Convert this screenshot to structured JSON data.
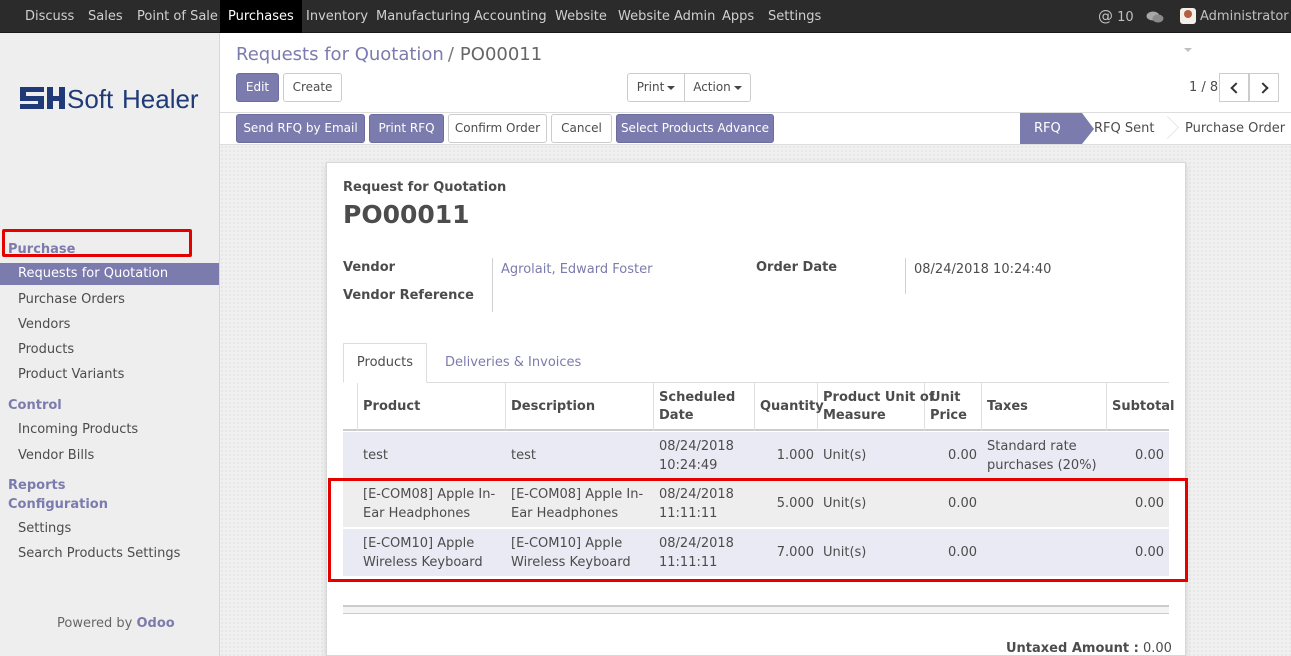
{
  "topbar": {
    "menu": [
      "Discuss",
      "Sales",
      "Point of Sale",
      "Purchases",
      "Inventory",
      "Manufacturing",
      "Accounting",
      "Website",
      "Website Admin",
      "Apps",
      "Settings"
    ],
    "active": "Purchases",
    "mentions_count": "10",
    "user": "Administrator"
  },
  "sidebar": {
    "logo_text": "SoftHealer",
    "sections": [
      {
        "title": "Purchase",
        "items": [
          "Requests for Quotation",
          "Purchase Orders",
          "Vendors",
          "Products",
          "Product Variants"
        ]
      },
      {
        "title": "Control",
        "items": [
          "Incoming Products",
          "Vendor Bills"
        ]
      },
      {
        "title": "Reports",
        "items": []
      },
      {
        "title": "Configuration",
        "items": [
          "Settings",
          "Search Products Settings"
        ]
      }
    ],
    "active_item": "Requests for Quotation",
    "powered_prefix": "Powered by",
    "powered_brand": "Odoo"
  },
  "breadcrumb": {
    "parent": "Requests for Quotation",
    "separator": "/",
    "current": "PO00011"
  },
  "controls": {
    "edit": "Edit",
    "create": "Create",
    "print": "Print",
    "action": "Action",
    "pager": "1 / 8"
  },
  "header_buttons": [
    "Send RFQ by Email",
    "Print RFQ",
    "Confirm Order",
    "Cancel",
    "Select Products Advance"
  ],
  "status": {
    "stages": [
      "RFQ",
      "RFQ Sent",
      "Purchase Order"
    ],
    "active": "RFQ"
  },
  "form": {
    "doc_type": "Request for Quotation",
    "name": "PO00011",
    "vendor_label": "Vendor",
    "vendor_value": "Agrolait, Edward Foster",
    "vendor_ref_label": "Vendor Reference",
    "vendor_ref_value": "",
    "order_date_label": "Order Date",
    "order_date_value": "08/24/2018 10:24:40"
  },
  "tabs": [
    "Products",
    "Deliveries & Invoices"
  ],
  "table": {
    "headers": {
      "product": "Product",
      "description": "Description",
      "scheduled_1": "Scheduled",
      "scheduled_2": "Date",
      "quantity": "Quantity",
      "uom_1": "Product Unit of",
      "uom_2": "Measure",
      "price_1": "Unit",
      "price_2": "Price",
      "taxes": "Taxes",
      "subtotal": "Subtotal"
    },
    "rows": [
      {
        "product_1": "test",
        "product_2": "",
        "desc_1": "test",
        "desc_2": "",
        "date_1": "08/24/2018",
        "date_2": "10:24:49",
        "qty": "1.000",
        "uom": "Unit(s)",
        "price": "0.00",
        "tax_1": "Standard rate",
        "tax_2": "purchases (20%)",
        "subtotal": "0.00"
      },
      {
        "product_1": "[E-COM08] Apple In-",
        "product_2": "Ear Headphones",
        "desc_1": "[E-COM08] Apple In-",
        "desc_2": "Ear Headphones",
        "date_1": "08/24/2018",
        "date_2": "11:11:11",
        "qty": "5.000",
        "uom": "Unit(s)",
        "price": "0.00",
        "tax_1": "",
        "tax_2": "",
        "subtotal": "0.00"
      },
      {
        "product_1": "[E-COM10] Apple",
        "product_2": "Wireless Keyboard",
        "desc_1": "[E-COM10] Apple",
        "desc_2": "Wireless Keyboard",
        "date_1": "08/24/2018",
        "date_2": "11:11:11",
        "qty": "7.000",
        "uom": "Unit(s)",
        "price": "0.00",
        "tax_1": "",
        "tax_2": "",
        "subtotal": "0.00"
      }
    ]
  },
  "totals": {
    "untaxed_label": "Untaxed Amount :",
    "untaxed_value": "0.00"
  },
  "colors": {
    "accent": "#7c7bad",
    "navbar": "#2b2b2b",
    "highlight": "#e50000"
  }
}
